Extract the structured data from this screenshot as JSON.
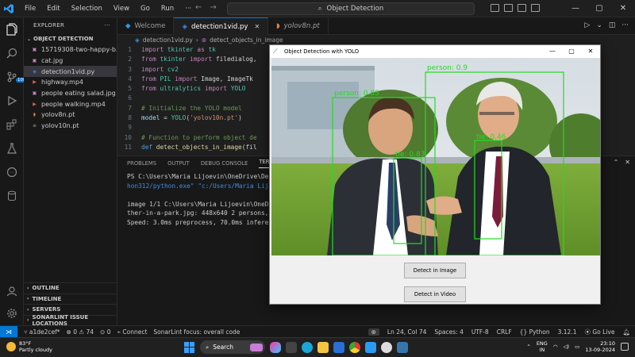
{
  "titlebar": {
    "menu": [
      "File",
      "Edit",
      "Selection",
      "View",
      "Go",
      "Run",
      "···"
    ],
    "search_text": "Object Detection"
  },
  "explorer": {
    "header": "EXPLORER",
    "folder": "OBJECT DETECTION",
    "files": [
      {
        "name": "15719308-two-happy-b...",
        "icon": "image-icon",
        "color": "#c586c0"
      },
      {
        "name": "cat.jpg",
        "icon": "image-icon",
        "color": "#c586c0"
      },
      {
        "name": "detection1vid.py",
        "icon": "python-icon",
        "color": "#3b8eea"
      },
      {
        "name": "highway.mp4",
        "icon": "video-icon",
        "color": "#e05a5a"
      },
      {
        "name": "people eating salad.jpg",
        "icon": "image-icon",
        "color": "#c586c0"
      },
      {
        "name": "people walking.mp4",
        "icon": "video-icon",
        "color": "#e05a5a"
      },
      {
        "name": "yolov8n.pt",
        "icon": "rss-icon",
        "color": "#e8833a"
      },
      {
        "name": "yolov10n.pt",
        "icon": "file-icon",
        "color": "#9d9d9d"
      }
    ],
    "sections": [
      "OUTLINE",
      "TIMELINE",
      "SERVERS",
      "SONARLINT ISSUE LOCATIONS"
    ],
    "scm_badge": "10K"
  },
  "tabs": [
    {
      "label": "Welcome",
      "active": false
    },
    {
      "label": "detection1vid.py",
      "active": true
    },
    {
      "label": "yolov8n.pt",
      "active": false
    }
  ],
  "breadcrumb": {
    "file": "detection1vid.py",
    "symbol": "detect_objects_in_image"
  },
  "code": {
    "line_numbers": [
      "1",
      "2",
      "3",
      "4",
      "5",
      "6",
      "7",
      "8",
      "9",
      "10",
      "11"
    ],
    "lines": [
      [
        {
          "t": "import ",
          "c": "kw"
        },
        {
          "t": "tkinter ",
          "c": "cls"
        },
        {
          "t": "as ",
          "c": "kw"
        },
        {
          "t": "tk",
          "c": "cls"
        }
      ],
      [
        {
          "t": "from ",
          "c": "kw"
        },
        {
          "t": "tkinter ",
          "c": "cls"
        },
        {
          "t": "import ",
          "c": "kw"
        },
        {
          "t": "filedialog, ",
          "c": "plain"
        }
      ],
      [
        {
          "t": "import ",
          "c": "kw"
        },
        {
          "t": "cv2",
          "c": "cls"
        }
      ],
      [
        {
          "t": "from ",
          "c": "kw"
        },
        {
          "t": "PIL ",
          "c": "cls"
        },
        {
          "t": "import ",
          "c": "kw"
        },
        {
          "t": "Image, ImageTk",
          "c": "plain"
        }
      ],
      [
        {
          "t": "from ",
          "c": "kw"
        },
        {
          "t": "ultralytics ",
          "c": "cls"
        },
        {
          "t": "import ",
          "c": "kw"
        },
        {
          "t": "YOLO",
          "c": "cls"
        }
      ],
      [],
      [
        {
          "t": "# Initialize the YOLO model",
          "c": "com"
        }
      ],
      [
        {
          "t": "model ",
          "c": "var"
        },
        {
          "t": "= ",
          "c": "plain"
        },
        {
          "t": "YOLO",
          "c": "cls"
        },
        {
          "t": "(",
          "c": "plain"
        },
        {
          "t": "'yolov10n.pt'",
          "c": "str"
        },
        {
          "t": ")",
          "c": "plain"
        }
      ],
      [],
      [
        {
          "t": "# Function to perform object de",
          "c": "com"
        }
      ],
      [
        {
          "t": "def ",
          "c": "kw2"
        },
        {
          "t": "detect_objects_in_image",
          "c": "fn"
        },
        {
          "t": "(fil",
          "c": "plain"
        }
      ]
    ]
  },
  "panel": {
    "tabs": [
      "PROBLEMS",
      "OUTPUT",
      "DEBUG CONSOLE",
      "TERMI"
    ],
    "terminal": [
      {
        "t": "PS C:\\Users\\Maria Lijoevin\\OneDrive\\Des",
        "c": ""
      },
      {
        "t": "hon312/python.exe\" \"c:/Users/Maria Lijo",
        "c": "cyan"
      },
      {
        "t": "",
        "c": ""
      },
      {
        "t": "image 1/1 C:\\Users\\Maria Lijoevin\\OneDrive",
        "c": ""
      },
      {
        "t": "ther-in-a-park.jpg: 448x640 2 persons, ",
        "c": ""
      },
      {
        "t": "Speed: 3.0ms preprocess, 70.0ms inferen",
        "c": ""
      }
    ]
  },
  "statusbar": {
    "branch": "a1de2cef*",
    "problems": "⊗ 0 ⚠ 74",
    "ports": "0",
    "connect": "Connect",
    "sonar": "SonarLint focus: overall code",
    "position": "Ln 24, Col 74",
    "spaces": "Spaces: 4",
    "encoding": "UTF-8",
    "eol": "CRLF",
    "language": "{} Python",
    "version": "3.12.1",
    "golive": "Go Live"
  },
  "tkwindow": {
    "title": "Object Detection with YOLO",
    "btn_image": "Detect in Image",
    "btn_video": "Detect in Video",
    "detections": [
      {
        "label": "person: 0.85"
      },
      {
        "label": "person: 0.9"
      },
      {
        "label": "tie: 0.83"
      },
      {
        "label": "tie: 0.46"
      }
    ]
  },
  "taskbar": {
    "temp": "83°F",
    "weather": "Partly cloudy",
    "search": "Search",
    "lang_top": "ENG",
    "lang_bottom": "IN",
    "time": "23:10",
    "date": "13-09-2024"
  }
}
